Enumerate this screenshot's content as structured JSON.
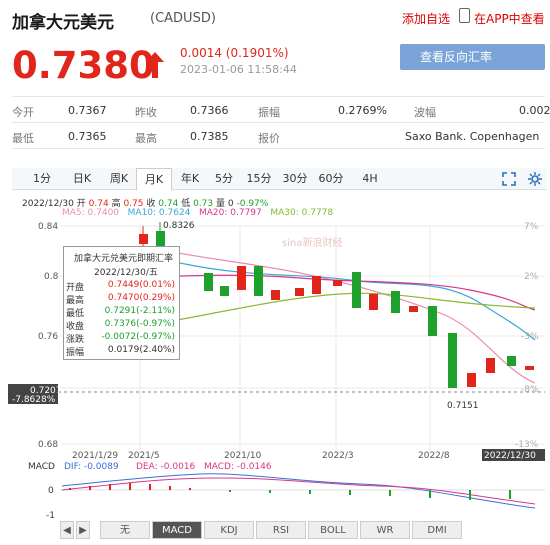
{
  "header": {
    "title": "加拿大元美元",
    "code": "(CADUSD)",
    "add_watch": "添加自选",
    "app_view": "在APP中查看"
  },
  "price": {
    "value": "0.7380",
    "change": "0.0014 (0.1901%)",
    "timestamp": "2023-01-06 11:58:44",
    "reverse_btn": "查看反向汇率 USDCAD"
  },
  "stats": [
    {
      "label": "今开",
      "value": "0.7367"
    },
    {
      "label": "昨收",
      "value": "0.7366"
    },
    {
      "label": "振幅",
      "value": "0.2769%"
    },
    {
      "label": "波幅",
      "value": "0.002"
    },
    {
      "label": "最低",
      "value": "0.7365"
    },
    {
      "label": "最高",
      "value": "0.7385"
    },
    {
      "label": "报价",
      "value": "Saxo Bank. Copenhagen"
    }
  ],
  "tabs": [
    "1分",
    "日K",
    "周K",
    "月K",
    "年K",
    "5分",
    "15分",
    "30分",
    "60分",
    "4H"
  ],
  "chart_info": {
    "ohlc_date": "2022/12/30",
    "ohlc_open_l": "开",
    "ohlc_open": "0.74",
    "ohlc_high_l": "高",
    "ohlc_high": "0.75",
    "ohlc_close_l": "收",
    "ohlc_close": "0.74",
    "ohlc_low_l": "低",
    "ohlc_low": "0.73",
    "ohlc_vol_l": "量",
    "ohlc_vol": "0",
    "ohlc_pct": "-0.97%",
    "ma5": "MA5: 0.7400",
    "ma10": "MA10: 0.7624",
    "ma20": "MA20: 0.7797",
    "ma30": "MA30: 0.7778",
    "y_labels": [
      "0.84",
      "0.8",
      "0.76",
      "0.72",
      "0.68"
    ],
    "pct_labels": [
      "7%",
      "2%",
      "-3%",
      "-8%",
      "-13%"
    ],
    "x_labels": [
      "2021/1/29",
      "2021/5",
      "2021/10",
      "2022/3",
      "2022/8",
      "2022/12/30"
    ],
    "max_label": "0.8326",
    "min_label": "0.7151",
    "cursor_price": "0.7207",
    "cursor_pct": "-7.8628%",
    "watermark": "sina新浪财经"
  },
  "tooltip": {
    "title": "加拿大元兑美元即期汇率",
    "date": "2022/12/30/五",
    "rows": [
      {
        "k": "开盘",
        "v": "0.7449(0.01%)"
      },
      {
        "k": "最高",
        "v": "0.7470(0.29%)"
      },
      {
        "k": "最低",
        "v": "0.7291(-2.11%)"
      },
      {
        "k": "收盘",
        "v": "0.7376(-0.97%)"
      },
      {
        "k": "涨跌",
        "v": "-0.0072(-0.97%)"
      },
      {
        "k": "振幅",
        "v": "0.0179(2.40%)"
      }
    ]
  },
  "macd": {
    "label": "MACD",
    "dif": "DIF: -0.0089",
    "dea": "DEA: -0.0016",
    "macd": "MACD: -0.0146",
    "y_labels": [
      "0",
      "-1"
    ]
  },
  "bottom_tabs": [
    "无",
    "MACD",
    "KDJ",
    "RSI",
    "BOLL",
    "WR",
    "DMI"
  ],
  "colors": {
    "up": "#e1251b",
    "down": "#1da12c",
    "accent": "#7aa4d7"
  }
}
